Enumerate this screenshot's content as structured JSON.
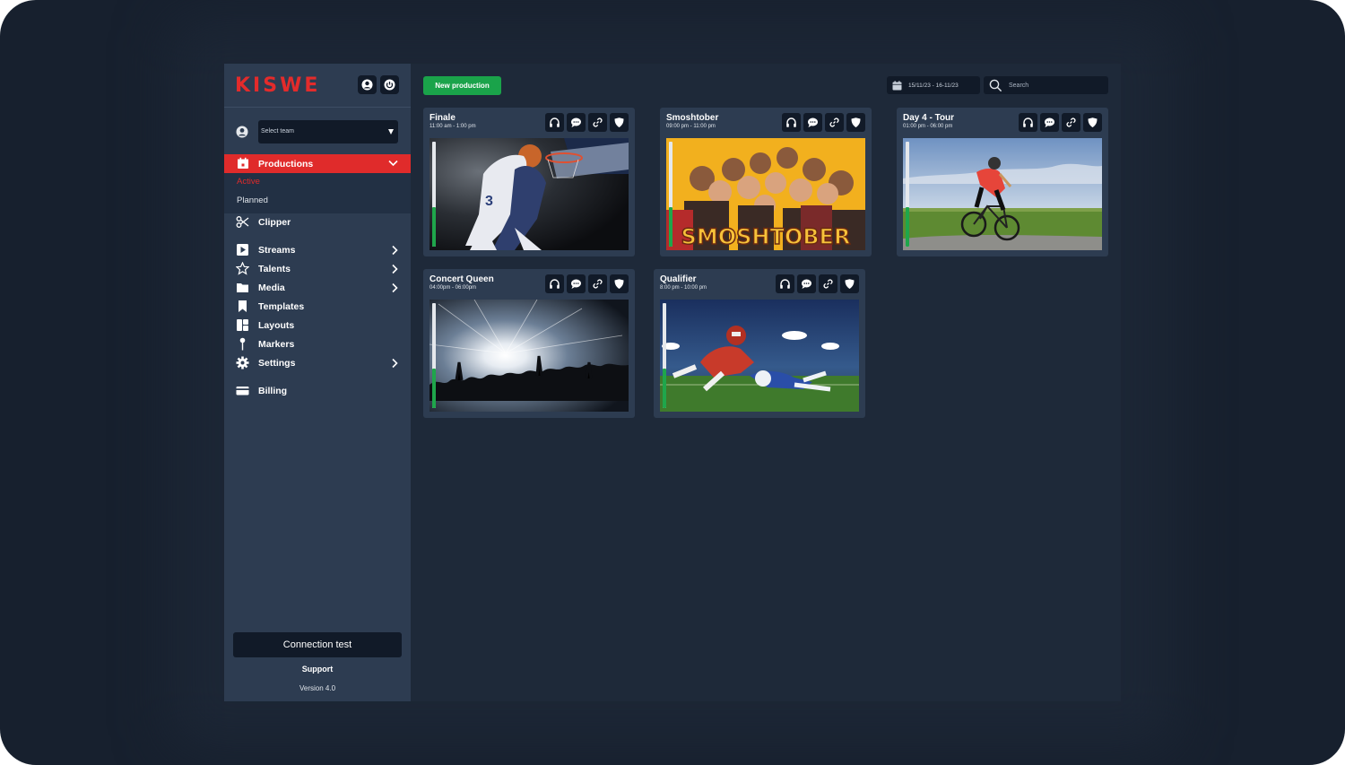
{
  "app": {
    "brand": "KISWE",
    "brand_color": "#e02b2b",
    "accent_green": "#1aa34a"
  },
  "sidebar": {
    "team_select": {
      "value": "Select team"
    },
    "productions": {
      "label": "Productions",
      "sub_items": [
        {
          "label": "Active",
          "active": true
        },
        {
          "label": "Planned",
          "active": false
        }
      ]
    },
    "items": [
      {
        "label": "Clipper",
        "icon": "scissors-icon",
        "has_submenu": false
      },
      {
        "label": "Streams",
        "icon": "play-icon",
        "has_submenu": true
      },
      {
        "label": "Talents",
        "icon": "star-icon",
        "has_submenu": true
      },
      {
        "label": "Media",
        "icon": "folder-icon",
        "has_submenu": true
      },
      {
        "label": "Templates",
        "icon": "bookmark-icon",
        "has_submenu": false
      },
      {
        "label": "Layouts",
        "icon": "layout-icon",
        "has_submenu": false
      },
      {
        "label": "Markers",
        "icon": "pin-icon",
        "has_submenu": false
      },
      {
        "label": "Settings",
        "icon": "gear-icon",
        "has_submenu": true
      },
      {
        "label": "Billing",
        "icon": "card-icon",
        "has_submenu": false
      }
    ],
    "connection_test": "Connection test",
    "support": "Support",
    "version": "Version 4.0"
  },
  "header": {
    "new_production": "New production",
    "date_range": "15/11/23 -  16-11/23",
    "search_placeholder": "Search"
  },
  "productions": [
    {
      "title": "Finale",
      "time": "11:00 am - 1:00 pm",
      "thumbnail": "basketball-dunk",
      "audio_level": 0.38
    },
    {
      "title": "Smoshtober",
      "time": "09:00 pm - 11:00 pm",
      "thumbnail": "smoshtober-group",
      "thumbnail_text": "SMOSHTOBER",
      "audio_level": 0.38
    },
    {
      "title": "Day 4 - Tour",
      "time": "01:00 pm - 06:00 pm",
      "thumbnail": "road-cyclist",
      "audio_level": 0.38
    },
    {
      "title": "Concert Queen",
      "time": "04:00pm - 06:00pm",
      "thumbnail": "concert-crowd",
      "audio_level": 0.38
    },
    {
      "title": "Qualifier",
      "time": "8:00 pm - 10:00 pm",
      "thumbnail": "football-dive",
      "audio_level": 0.38
    }
  ],
  "card_actions": [
    "headphones-icon",
    "chat-icon",
    "link-icon",
    "shield-icon"
  ]
}
